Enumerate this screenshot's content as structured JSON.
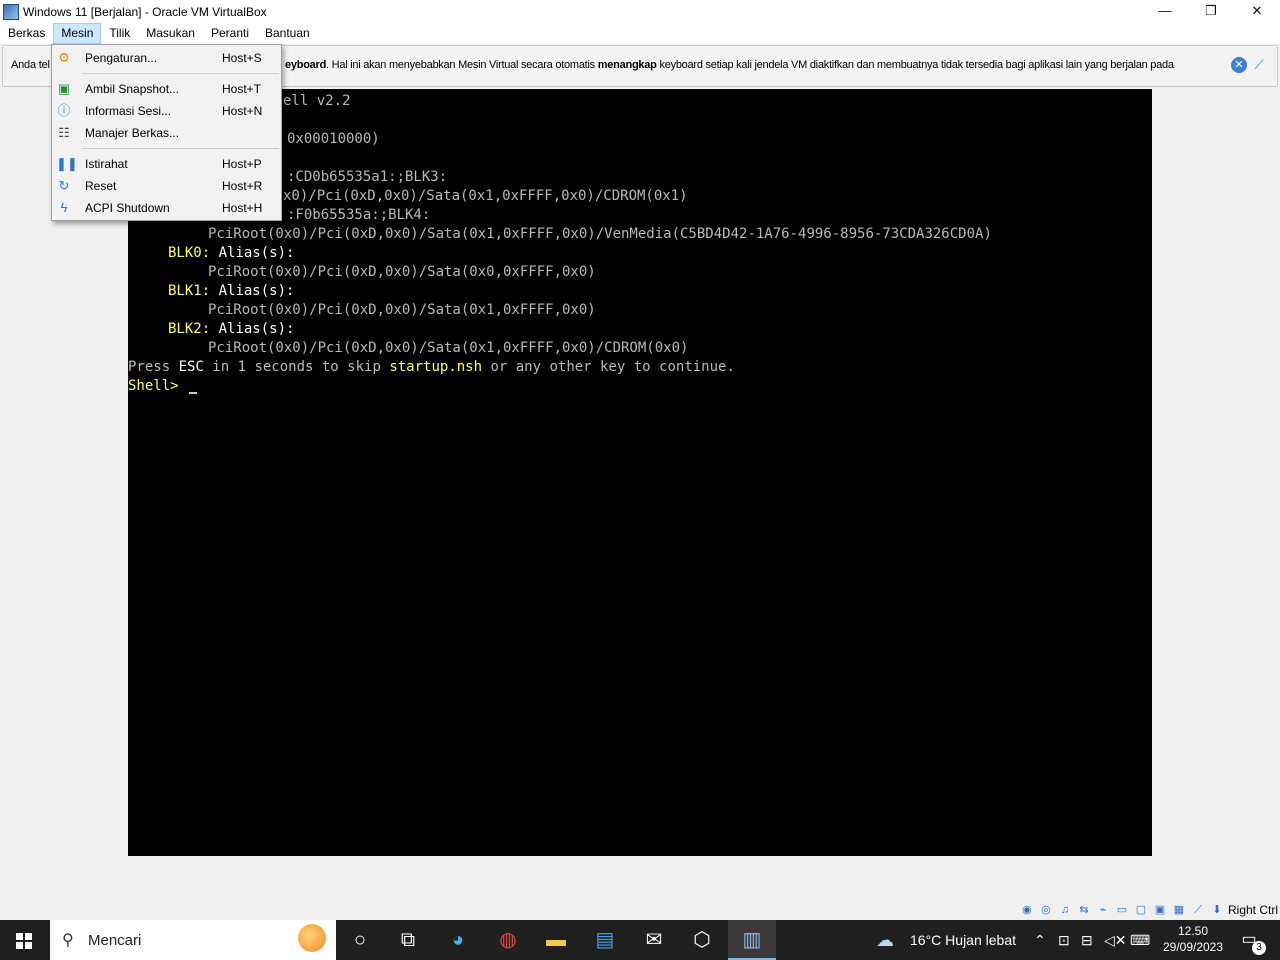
{
  "window": {
    "title": "Windows 11 [Berjalan] - Oracle VM VirtualBox",
    "minimize": "—",
    "restore": "❐",
    "close": "✕"
  },
  "menubar": [
    "Berkas",
    "Mesin",
    "Tilik",
    "Masukan",
    "Peranti",
    "Bantuan"
  ],
  "notification": {
    "prefix": "Anda tel",
    "bold1": "eyboard",
    "middle": ". Hal ini akan menyebabkan Mesin Virtual secara otomatis ",
    "bold2": "menangkap",
    "suffix": " keyboard setiap kali jendela VM diaktifkan dan membuatnya tidak tersedia bagi aplikasi lain yang berjalan pada"
  },
  "dropdown": {
    "items": [
      {
        "label": "Pengaturan...",
        "shortcut": "Host+S",
        "icon": "gear-icon"
      },
      {
        "label": "Ambil Snapshot...",
        "shortcut": "Host+T",
        "icon": "snapshot-icon"
      },
      {
        "label": "Informasi Sesi...",
        "shortcut": "Host+N",
        "icon": "info-icon"
      },
      {
        "label": "Manajer Berkas...",
        "shortcut": "",
        "icon": "file-manager-icon"
      },
      {
        "label": "Istirahat",
        "shortcut": "Host+P",
        "icon": "pause-icon"
      },
      {
        "label": "Reset",
        "shortcut": "Host+R",
        "icon": "reset-icon"
      },
      {
        "label": "ACPI Shutdown",
        "shortcut": "Host+H",
        "icon": "power-icon"
      }
    ]
  },
  "console": {
    "line1": "ell v2.2",
    "line2": "0x00010000)",
    "line3": ":CD0b65535a1:;BLK3:",
    "line4": "x0)/Pci(0xD,0x0)/Sata(0x1,0xFFFF,0x0)/CDROM(0x1)",
    "line5": ":F0b65535a:;BLK4:",
    "line6": "PciRoot(0x0)/Pci(0xD,0x0)/Sata(0x1,0xFFFF,0x0)/VenMedia(C5BD4D42-1A76-4996-8956-73CDA326CD0A)",
    "blk0": "BLK0:",
    "blk1": "BLK1:",
    "blk2": "BLK2:",
    "alias": "Alias(s):",
    "path0": "PciRoot(0x0)/Pci(0xD,0x0)/Sata(0x0,0xFFFF,0x0)",
    "path1": "PciRoot(0x0)/Pci(0xD,0x0)/Sata(0x1,0xFFFF,0x0)",
    "path2": "PciRoot(0x0)/Pci(0xD,0x0)/Sata(0x1,0xFFFF,0x0)/CDROM(0x0)",
    "press": "Press ",
    "esc": "ESC",
    "press_mid": " in 1 seconds to skip ",
    "startup": "startup.nsh",
    "press_end": " or any other key to continue.",
    "prompt": "Shell> "
  },
  "statusbar": {
    "hostkey": "Right Ctrl"
  },
  "taskbar": {
    "search_placeholder": "Mencari",
    "weather": "16°C  Hujan lebat",
    "time": "12.50",
    "date": "29/09/2023",
    "notification_count": "3"
  }
}
